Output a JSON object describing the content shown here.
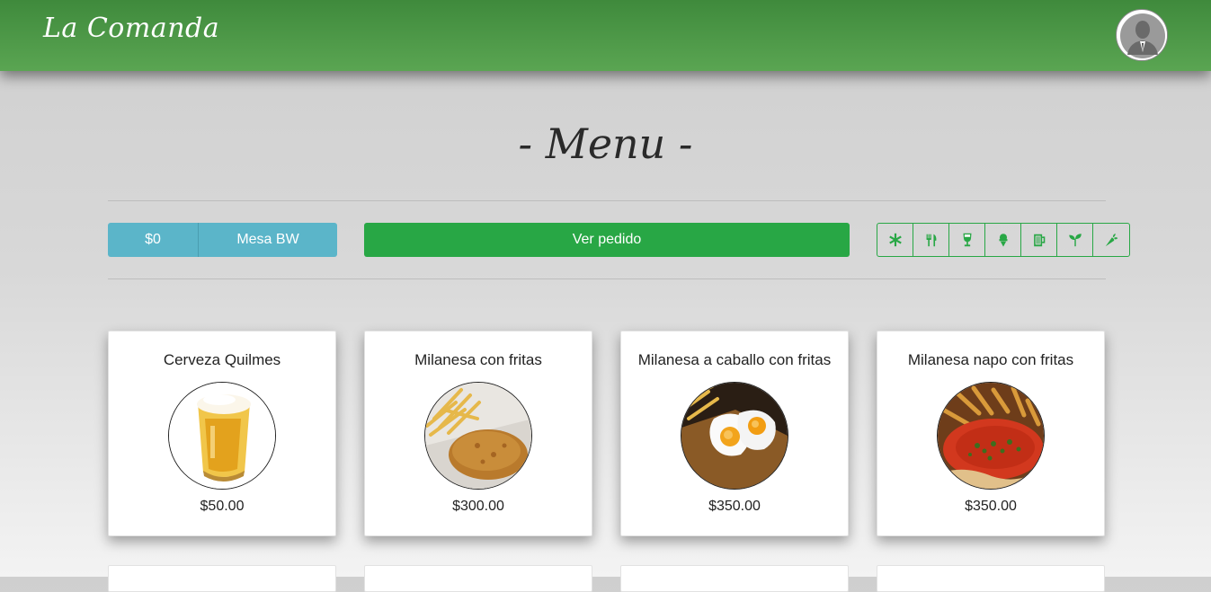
{
  "app": {
    "brand": "La Comanda"
  },
  "header": {
    "avatar": "user-avatar-icon"
  },
  "page": {
    "title": "- Menu -"
  },
  "toolbar": {
    "total": "$0",
    "mesa": "Mesa BW",
    "ver_pedido": "Ver pedido",
    "categories": [
      "asterisk-icon",
      "utensils-icon",
      "wine-glass-icon",
      "ice-cream-icon",
      "beer-mug-icon",
      "seedling-icon",
      "carrot-icon"
    ]
  },
  "colors": {
    "accent": "#28a745",
    "info": "#5bb5c9",
    "navbar": "#4a9a46"
  },
  "products": [
    {
      "name": "Cerveza Quilmes",
      "price": "$50.00",
      "image": "beer-glass"
    },
    {
      "name": "Milanesa con fritas",
      "price": "$300.00",
      "image": "milanesa-fries"
    },
    {
      "name": "Milanesa a caballo con fritas",
      "price": "$350.00",
      "image": "milanesa-eggs"
    },
    {
      "name": "Milanesa napo con fritas",
      "price": "$350.00",
      "image": "milanesa-napo"
    }
  ]
}
